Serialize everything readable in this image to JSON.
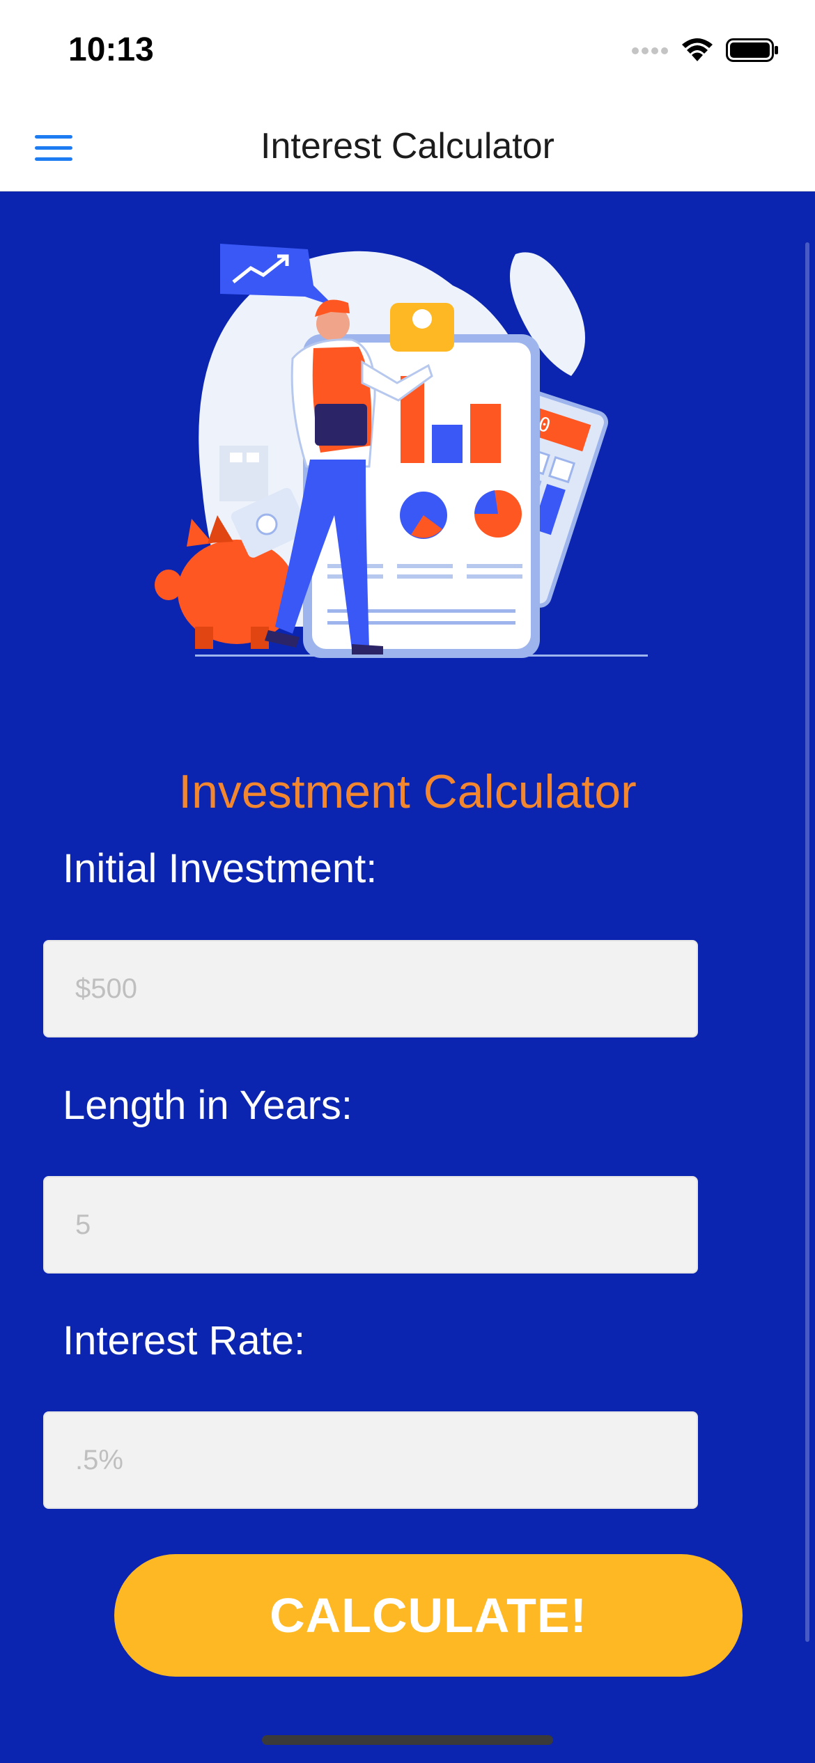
{
  "status_bar": {
    "time": "10:13"
  },
  "nav": {
    "title": "Interest Calculator",
    "menu_icon": "hamburger-menu-icon"
  },
  "main": {
    "section_title": "Investment Calculator",
    "fields": [
      {
        "label": "Initial Investment:",
        "placeholder": "$500"
      },
      {
        "label": "Length in Years:",
        "placeholder": "5"
      },
      {
        "label": "Interest Rate:",
        "placeholder": ".5%"
      }
    ],
    "calculate_label": "CALCULATE!"
  },
  "colors": {
    "background": "#0B25B0",
    "accent_orange": "#F3872F",
    "button_yellow": "#FDB824",
    "menu_blue": "#1E7CF2"
  }
}
